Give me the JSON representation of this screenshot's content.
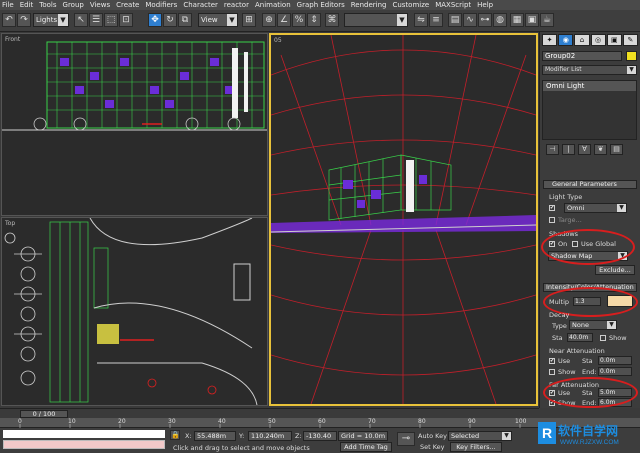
{
  "menu": [
    "File",
    "Edit",
    "Tools",
    "Group",
    "Views",
    "Create",
    "Modifiers",
    "Character",
    "reactor",
    "Animation",
    "Graph Editors",
    "Rendering",
    "Customize",
    "MAXScript",
    "Help"
  ],
  "toolbar": {
    "selection_filter": "Lights",
    "ref_coord": "View",
    "arrow": "▼"
  },
  "viewports": {
    "front": "Front",
    "perspective": "05",
    "top": "Top"
  },
  "command_panel": {
    "tabs": [
      "✦",
      "◉",
      "⌂",
      "◎",
      "▣",
      "✎"
    ],
    "object_name": "Group02",
    "object_color": "#f0e020",
    "modifier_list": "Modifier List",
    "stack_item": "Omni Light",
    "stack_buttons": [
      "⊣",
      "|",
      "∀",
      "❦",
      "▤"
    ],
    "general_params": {
      "title": "General Parameters",
      "light_type_label": "Light Type",
      "on_check": "✔",
      "light_type": "Omni",
      "targeted": "Targe...",
      "shadows_label": "Shadows",
      "shadows_on": "On",
      "use_global": "Use Global",
      "shadow_type": "Shadow Map",
      "exclude": "Exclude..."
    },
    "intensity": {
      "title": "Intensity/Color/Attenuation",
      "multiplier_label": "Multip",
      "multiplier": "1.3",
      "color": "#f5d9a8",
      "decay_label": "Decay",
      "type_label": "Type",
      "type_value": "None",
      "start_label": "Sta",
      "start_value": "40.0m",
      "show": "Show",
      "near_label": "Near Attenuation",
      "use": "Use",
      "near_start_label": "Sta",
      "near_start": "0.0m",
      "near_end_label": "End:",
      "near_end": "0.0m",
      "far_label": "Far Attenuation",
      "far_start_label": "Sta",
      "far_start": "5.0m",
      "far_end_label": "End:",
      "far_end": "6.0m"
    }
  },
  "timeline": {
    "frame": "0 / 100",
    "ticks": [
      "0",
      "10",
      "20",
      "30",
      "40",
      "50",
      "60",
      "70",
      "80",
      "90",
      "100"
    ]
  },
  "status": {
    "x_label": "X:",
    "x": "55.488m",
    "y_label": "Y:",
    "y": "110.240m",
    "z_label": "Z:",
    "z": "-130.40",
    "grid": "Grid = 10.0m",
    "prompt": "Click and drag to select and move objects",
    "add_time_tag": "Add Time Tag",
    "auto_key": "Auto Key",
    "selected": "Selected",
    "set_key": "Set Key",
    "key_filters": "Key Filters..."
  },
  "watermark": {
    "logo": "R",
    "text": "软件自学网",
    "url": "WWW.RJZXW.COM"
  }
}
